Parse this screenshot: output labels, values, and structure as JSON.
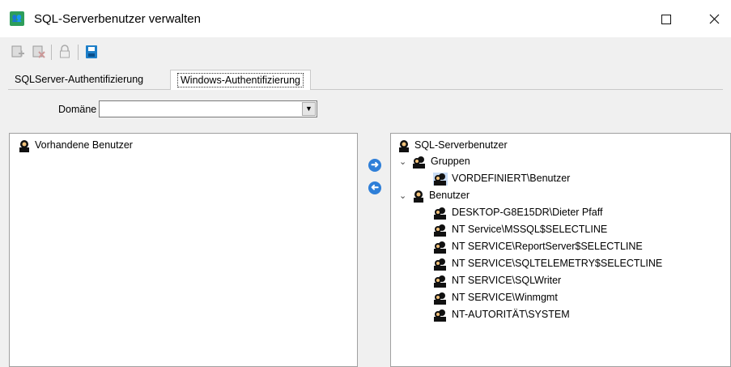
{
  "window": {
    "title": "SQL-Serverbenutzer verwalten",
    "icon": "users-app-icon"
  },
  "toolbar": {
    "buttons": [
      "add-user-icon",
      "delete-user-icon",
      "lock-icon",
      "save-icon"
    ]
  },
  "tabs": [
    {
      "label": "SQLServer-Authentifizierung",
      "active": false
    },
    {
      "label": "Windows-Authentifizierung",
      "active": true
    }
  ],
  "domain": {
    "label": "Domäne",
    "value": ""
  },
  "left_tree": {
    "root": "Vorhandene Benutzer"
  },
  "right_tree": {
    "root": "SQL-Serverbenutzer",
    "groups_label": "Gruppen",
    "groups": [
      "VORDEFINIERT\\Benutzer"
    ],
    "users_label": "Benutzer",
    "users": [
      "DESKTOP-G8E15DR\\Dieter Pfaff",
      "NT Service\\MSSQL$SELECTLINE",
      "NT SERVICE\\ReportServer$SELECTLINE",
      "NT SERVICE\\SQLTELEMETRY$SELECTLINE",
      "NT SERVICE\\SQLWriter",
      "NT SERVICE\\Winmgmt",
      "NT-AUTORITÄT\\SYSTEM"
    ]
  },
  "colors": {
    "accent": "#2f7fd8",
    "app_icon": "#2e9e5a"
  }
}
